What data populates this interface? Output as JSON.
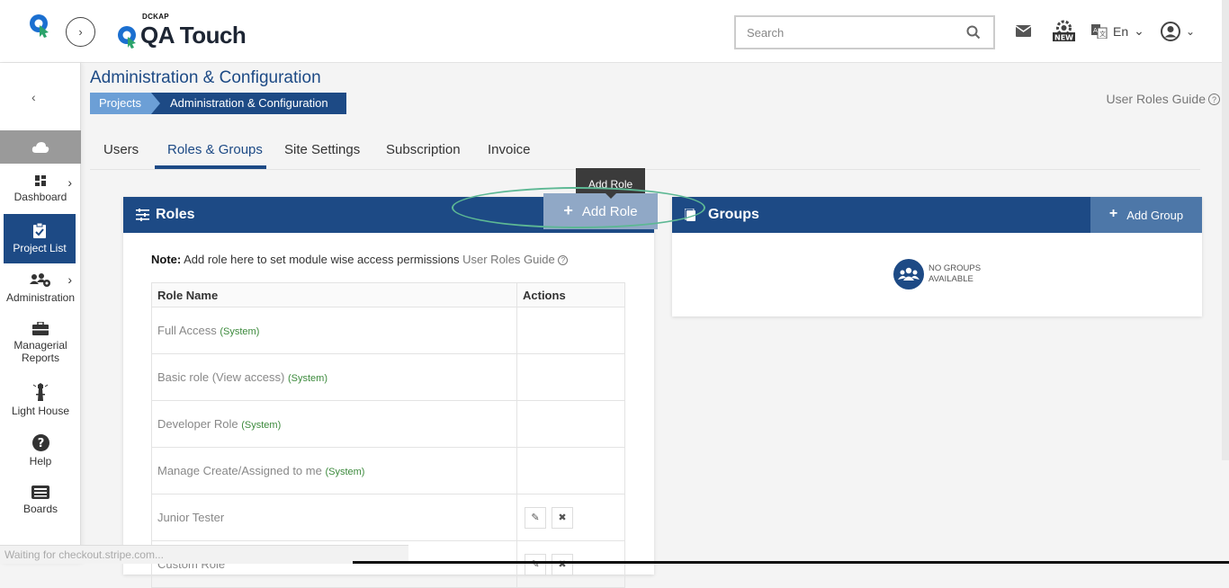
{
  "app": {
    "brand_small": "DCKAP",
    "brand_name": "QA Touch"
  },
  "header": {
    "search_placeholder": "Search",
    "lang_label": "En"
  },
  "sidebar": {
    "items": [
      {
        "label": "Dashboard"
      },
      {
        "label": "Project List"
      },
      {
        "label": "Administration"
      },
      {
        "label": "Managerial Reports"
      },
      {
        "label": "Light House"
      },
      {
        "label": "Help"
      },
      {
        "label": "Boards"
      }
    ]
  },
  "page": {
    "title": "Administration & Configuration",
    "breadcrumb": [
      "Projects",
      "Administration & Configuration"
    ],
    "guide_link": "User Roles Guide"
  },
  "tabs": [
    "Users",
    "Roles & Groups",
    "Site Settings",
    "Subscription",
    "Invoice"
  ],
  "roles": {
    "title": "Roles",
    "add_label": "Add Role",
    "tooltip": "Add Role",
    "note_bold": "Note:",
    "note_text": "Add role here to set module wise access permissions",
    "note_link": "User Roles Guide",
    "columns": [
      "Role Name",
      "Actions"
    ],
    "rows": [
      {
        "name": "Full Access",
        "tag": "(System)"
      },
      {
        "name": "Basic role (View access)",
        "tag": "(System)"
      },
      {
        "name": "Developer Role",
        "tag": "(System)"
      },
      {
        "name": "Manage Create/Assigned to me",
        "tag": "(System)"
      },
      {
        "name": "Junior Tester",
        "tag": ""
      },
      {
        "name": "Custom Role",
        "tag": ""
      }
    ]
  },
  "groups": {
    "title": "Groups",
    "add_label": "Add Group",
    "empty_line1": "NO GROUPS",
    "empty_line2": "AVAILABLE"
  },
  "status_bar": "Waiting for checkout.stripe.com..."
}
